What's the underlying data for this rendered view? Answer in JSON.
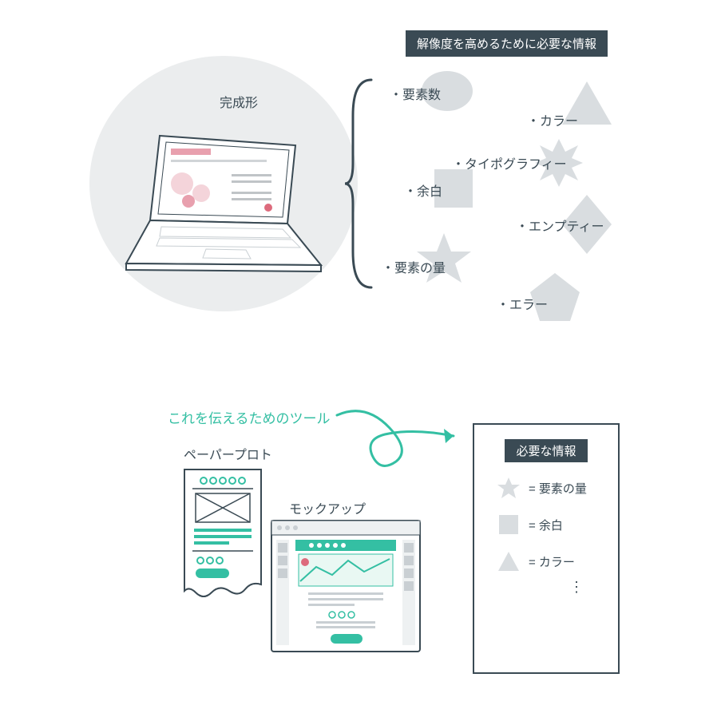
{
  "top": {
    "header": "解像度を高めるために必要な情報",
    "completed_label": "完成形",
    "items": {
      "elements_count": "・要素数",
      "color": "・カラー",
      "typography": "・タイポグラフィー",
      "margin": "・余白",
      "empty": "・エンプティー",
      "elements_amount": "・要素の量",
      "error": "・エラー"
    }
  },
  "bottom": {
    "tool_caption": "これを伝えるためのツール",
    "paper_proto": "ペーパープロト",
    "mockup": "モックアップ",
    "box_title": "必要な情報",
    "legend": {
      "amount": "= 要素の量",
      "margin": "= 余白",
      "color": "= カラー"
    },
    "ellipsis": "⋮"
  }
}
